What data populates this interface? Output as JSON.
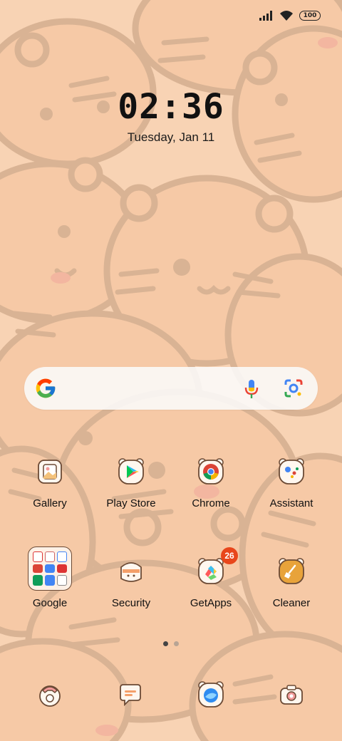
{
  "status_bar": {
    "battery_level": "100",
    "signal_icon": "signal-bars-icon",
    "wifi_icon": "wifi-icon"
  },
  "lockscreen_widget": {
    "time": "02:36",
    "date": "Tuesday, Jan 11"
  },
  "search_bar": {
    "logo_icon": "google-g-icon",
    "voice_icon": "microphone-icon",
    "lens_icon": "camera-lens-icon"
  },
  "home_row_1": [
    {
      "label": "Gallery",
      "icon": "gallery-icon"
    },
    {
      "label": "Play Store",
      "icon": "play-store-icon"
    },
    {
      "label": "Chrome",
      "icon": "chrome-icon"
    },
    {
      "label": "Assistant",
      "icon": "assistant-icon"
    }
  ],
  "home_row_2": [
    {
      "label": "Google",
      "icon": "folder-icon"
    },
    {
      "label": "Security",
      "icon": "security-icon"
    },
    {
      "label": "GetApps",
      "icon": "getapps-icon",
      "badge": "26"
    },
    {
      "label": "Cleaner",
      "icon": "cleaner-icon"
    }
  ],
  "page_indicator": {
    "current": 1,
    "total": 2
  },
  "dock": [
    {
      "icon": "phone-icon"
    },
    {
      "icon": "messages-icon"
    },
    {
      "icon": "browser-icon"
    },
    {
      "icon": "camera-icon"
    }
  ],
  "colors": {
    "wallpaper": "#f8d3b4",
    "badge": "#e8461b"
  }
}
